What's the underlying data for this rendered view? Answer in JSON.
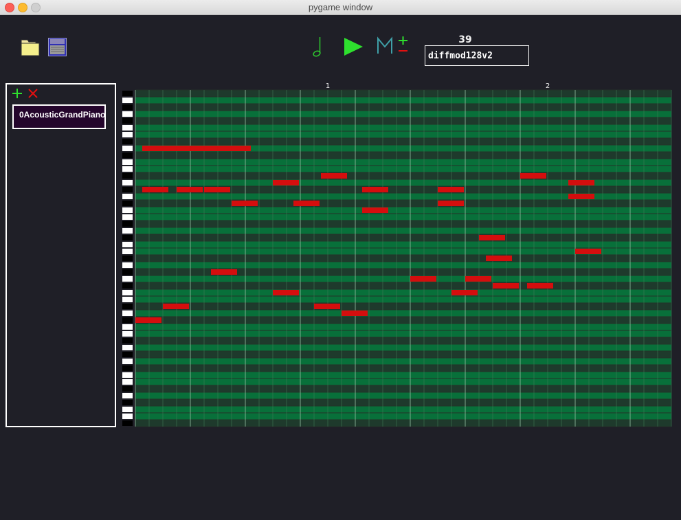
{
  "window": {
    "title": "pygame window"
  },
  "toolbar": {
    "open_icon": "folder-icon",
    "save_icon": "floppy-disk-icon",
    "note_icon": "eighth-note-icon",
    "play_icon": "play-icon",
    "mod_icon": "m-plus-minus-icon",
    "tempo": "39",
    "model_name": "diffmod128v2"
  },
  "track_panel": {
    "add_icon": "plus-icon",
    "remove_icon": "close-icon",
    "tracks": [
      {
        "label": "0AcousticGrandPiano"
      }
    ]
  },
  "piano_roll": {
    "measures": [
      "1",
      "2"
    ],
    "pitch_rows": 49,
    "steps": 39,
    "note_color": "#d40e0e",
    "light_row_color": "#08703a",
    "dark_row_color": "#1e3a2c",
    "notes": [
      {
        "row": 8,
        "start": 1,
        "length": 16
      },
      {
        "row": 12,
        "start": 27,
        "length": 4
      },
      {
        "row": 12,
        "start": 56,
        "length": 4
      },
      {
        "row": 13,
        "start": 20,
        "length": 4
      },
      {
        "row": 13,
        "start": 63,
        "length": 4
      },
      {
        "row": 14,
        "start": 1,
        "length": 4
      },
      {
        "row": 14,
        "start": 6,
        "length": 4
      },
      {
        "row": 14,
        "start": 10,
        "length": 4
      },
      {
        "row": 14,
        "start": 33,
        "length": 4
      },
      {
        "row": 14,
        "start": 44,
        "length": 4
      },
      {
        "row": 15,
        "start": 63,
        "length": 4
      },
      {
        "row": 16,
        "start": 14,
        "length": 4
      },
      {
        "row": 16,
        "start": 23,
        "length": 4
      },
      {
        "row": 16,
        "start": 44,
        "length": 4
      },
      {
        "row": 17,
        "start": 33,
        "length": 4
      },
      {
        "row": 21,
        "start": 50,
        "length": 4
      },
      {
        "row": 23,
        "start": 64,
        "length": 4
      },
      {
        "row": 24,
        "start": 51,
        "length": 4
      },
      {
        "row": 26,
        "start": 11,
        "length": 4
      },
      {
        "row": 27,
        "start": 40,
        "length": 4
      },
      {
        "row": 27,
        "start": 48,
        "length": 4
      },
      {
        "row": 28,
        "start": 52,
        "length": 4
      },
      {
        "row": 28,
        "start": 57,
        "length": 4
      },
      {
        "row": 29,
        "start": 20,
        "length": 4
      },
      {
        "row": 29,
        "start": 46,
        "length": 4
      },
      {
        "row": 31,
        "start": 4,
        "length": 4
      },
      {
        "row": 31,
        "start": 26,
        "length": 4
      },
      {
        "row": 32,
        "start": 30,
        "length": 4
      },
      {
        "row": 33,
        "start": 0,
        "length": 4
      }
    ]
  }
}
